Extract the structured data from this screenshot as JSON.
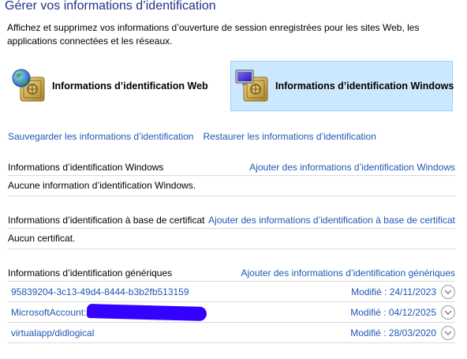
{
  "header": {
    "title": "Gérer vos informations d’identification",
    "intro": "Affichez et supprimez vos informations d’ouverture de session enregistrées pour les sites Web, les applications connectées et les réseaux."
  },
  "tiles": [
    {
      "label": "Informations d’identification Web",
      "icon": "web-vault-icon",
      "selected": false
    },
    {
      "label": "Informations d’identification Windows",
      "icon": "windows-vault-icon",
      "selected": true
    }
  ],
  "actions": {
    "backup": "Sauvegarder les informations d’identification",
    "restore": "Restaurer les informations d’identification"
  },
  "sections": {
    "windows": {
      "title": "Informations d’identification Windows",
      "add": "Ajouter des informations d’identification Windows",
      "empty": "Aucune information d’identification Windows."
    },
    "certificate": {
      "title": "Informations d’identification à base de certificat",
      "add": "Ajouter des informations d’identification à base de certificat",
      "empty": "Aucun certificat."
    },
    "generic": {
      "title": "Informations d’identification génériques",
      "add": "Ajouter des informations d’identification génériques",
      "items": [
        {
          "name": "95839204-3c13-49d4-8444-b3b2fb513159",
          "modified": "Modifié : 24/11/2023"
        },
        {
          "name": "MicrosoftAccount:",
          "modified": "Modifié : 04/12/2025"
        },
        {
          "name": "virtualapp/didlogical",
          "modified": "Modifié : 28/03/2020"
        }
      ]
    }
  },
  "colors": {
    "link": "#1e58b4",
    "title": "#1e3287",
    "selected_tile": "#cce8ff",
    "redaction": "#3500ff"
  }
}
